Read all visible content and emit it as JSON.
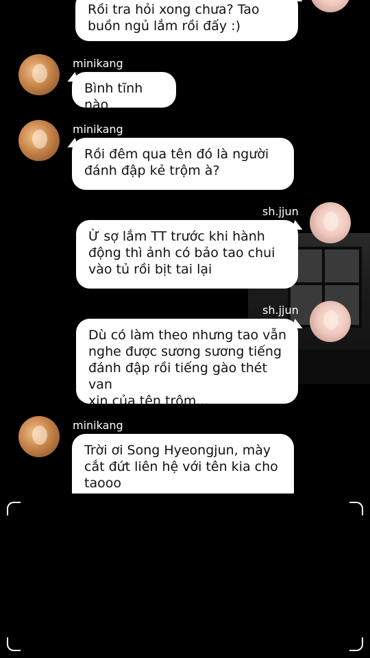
{
  "messages": [
    {
      "sender": "sh.jjun",
      "text": "Rồi tra hỏi xong chưa? Tao\nbuồn ngủ lắm rồi đấy :)"
    },
    {
      "sender": "minikang",
      "text": "Bình tĩnh nào"
    },
    {
      "sender": "minikang",
      "text": "Rồi đêm qua tên đó là người\nđánh đập kẻ trộm à?"
    },
    {
      "sender": "sh.jjun",
      "text": "Ừ sợ lắm TT trước khi hành\nđộng thì ảnh có bảo tao chui\nvào tủ rồi bịt tai lại"
    },
    {
      "sender": "sh.jjun",
      "text": "Dù có làm theo nhưng tao vẫn\nnghe được sương sương tiếng\nđánh đập rồi tiếng gào thét van\nxin của tên trộm..."
    },
    {
      "sender": "minikang",
      "text": "Trời ơi Song Hyeongjun, mày\ncắt đứt liên hệ với tên kia cho\ntaooo"
    }
  ]
}
